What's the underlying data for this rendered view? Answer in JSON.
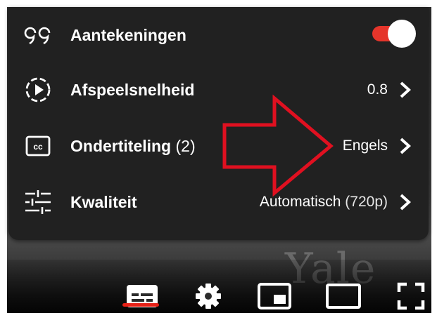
{
  "video": {
    "watermark": "Yale"
  },
  "settings_menu": {
    "rows": [
      {
        "label": "Aantekeningen",
        "icon": "annotations-quote-icon",
        "toggle_on": true
      },
      {
        "label": "Afspeelsnelheid",
        "icon": "playback-speed-icon",
        "value": "0.8"
      },
      {
        "label": "Ondertiteling",
        "count": "(2)",
        "icon": "closed-captions-icon",
        "value": "Engels"
      },
      {
        "label": "Kwaliteit",
        "icon": "quality-sliders-icon",
        "value": "Automatisch",
        "value_detail": "(720p)"
      }
    ]
  },
  "controls": {
    "subtitles_active": true,
    "accent_color": "#e62117",
    "items": [
      "subtitles-icon",
      "settings-gear-icon",
      "miniplayer-icon",
      "theater-mode-icon",
      "fullscreen-icon"
    ]
  },
  "annotation": {
    "arrow_color": "#e01020"
  }
}
